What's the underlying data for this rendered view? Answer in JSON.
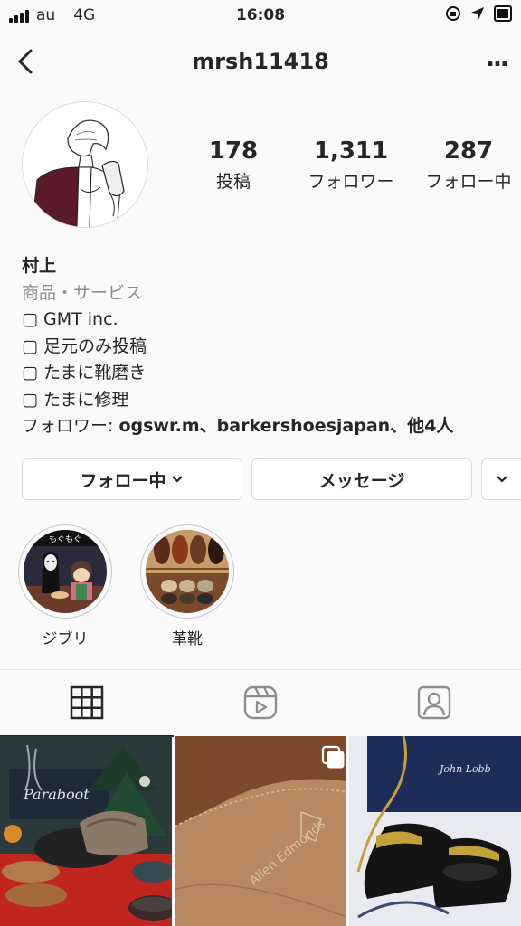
{
  "status_bar": {
    "carrier": "au",
    "network": "4G",
    "time": "16:08"
  },
  "header": {
    "username": "mrsh11418",
    "more_label": "..."
  },
  "stats": [
    {
      "value": "178",
      "label": "投稿"
    },
    {
      "value": "1,311",
      "label": "フォロワー"
    },
    {
      "value": "287",
      "label": "フォロー中"
    }
  ],
  "bio": {
    "name": "村上",
    "category": "商品・サービス",
    "lines": [
      "▢ GMT inc.",
      "▢ 足元のみ投稿",
      "▢ たまに靴磨き",
      "▢ たまに修理"
    ],
    "followed_by_prefix": "フォロワー: ",
    "followed_by_names": "ogswr.m、barkershoesjapan、",
    "followed_by_suffix": "他4人"
  },
  "buttons": {
    "following": "フォロー中",
    "message": "メッセージ"
  },
  "highlights": [
    {
      "label": "ジブリ",
      "caption": "もぐもぐ"
    },
    {
      "label": "革靴"
    }
  ],
  "posts": [
    {
      "box_text": "Paraboot"
    },
    {
      "stamp_text": "Allen Edmonds"
    },
    {
      "box_text": "John Lobb"
    }
  ],
  "colors": {
    "text": "#262626",
    "secondary": "#8e8e8e",
    "border": "#dbdbdb",
    "background": "#fafafa"
  }
}
